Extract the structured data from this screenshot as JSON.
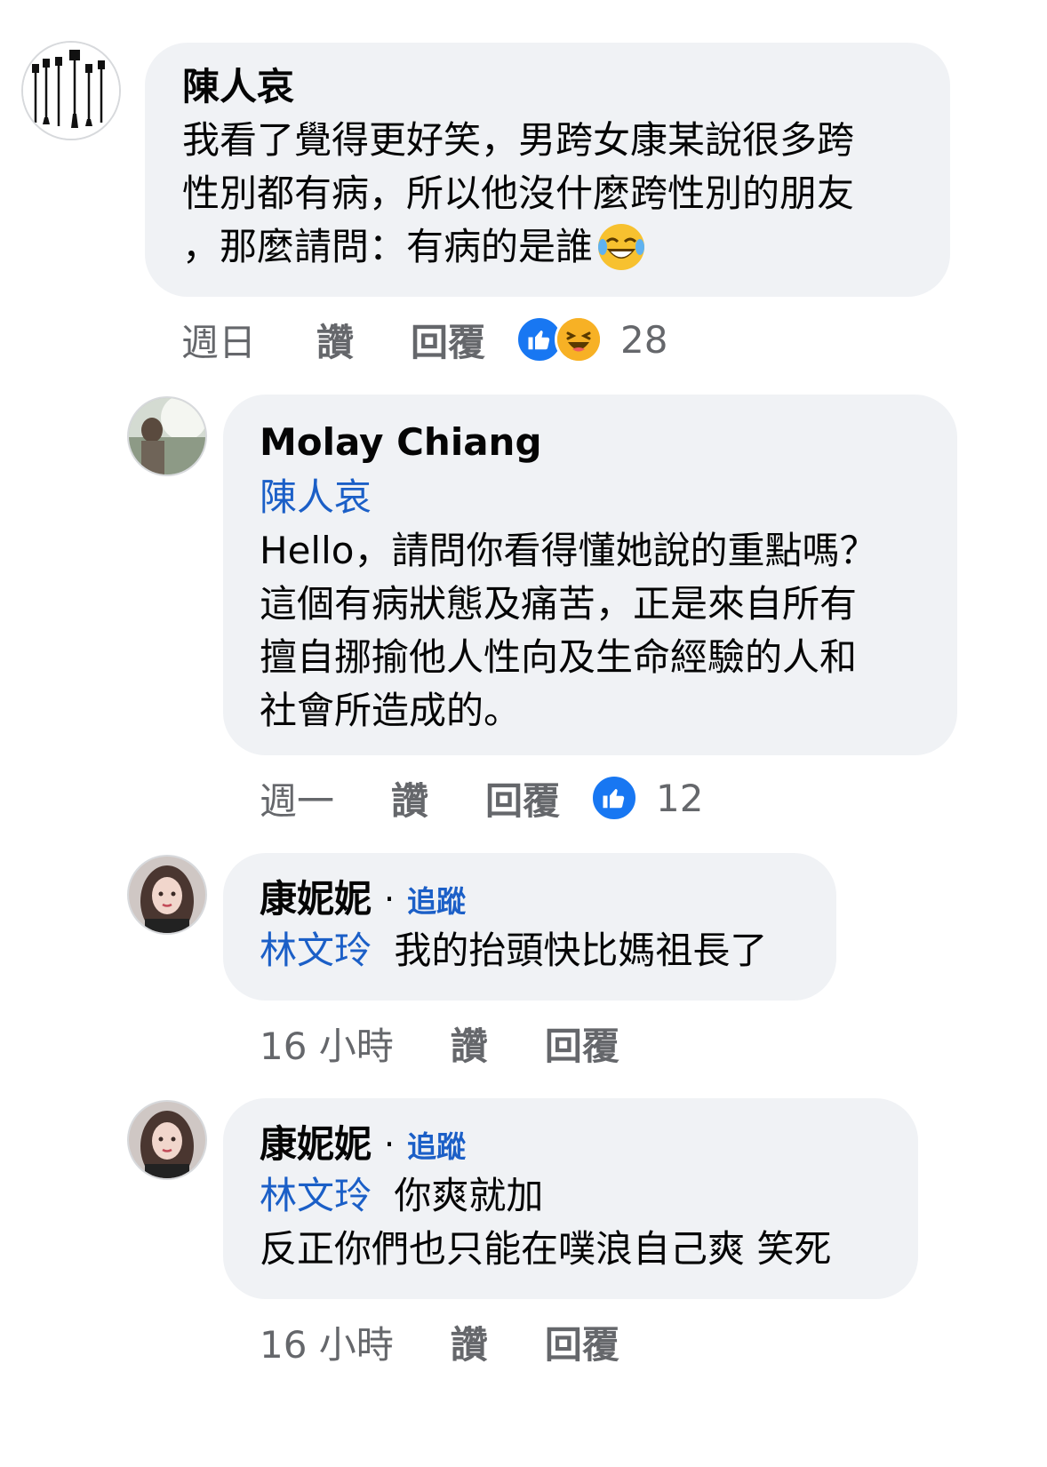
{
  "comments": [
    {
      "author": "陳人哀",
      "lines": [
        "我看了覺得更好笑，男跨女康某說很多跨",
        "性別都有病，所以他沒什麼跨性別的朋友",
        "，那麼請問：有病的是誰"
      ],
      "emoji": "😂",
      "time": "週日",
      "like_label": "讚",
      "reply_label": "回覆",
      "reaction_count": "28"
    },
    {
      "author": "Molay Chiang",
      "tag": "陳人哀",
      "lines": [
        "Hello，請問你看得懂她說的重點嗎？",
        "這個有病狀態及痛苦，正是來自所有",
        "擅自挪揄他人性向及生命經驗的人和",
        "社會所造成的。"
      ],
      "time": "週一",
      "like_label": "讚",
      "reply_label": "回覆",
      "reaction_count": "12"
    },
    {
      "author": "康妮妮",
      "separator": "·",
      "follow_label": "追蹤",
      "tag": "林文玲",
      "text": "我的抬頭快比媽祖長了",
      "time": "16 小時",
      "like_label": "讚",
      "reply_label": "回覆"
    },
    {
      "author": "康妮妮",
      "separator": "·",
      "follow_label": "追蹤",
      "tag": "林文玲",
      "text": "你爽就加",
      "line2": "反正你們也只能在噗浪自己爽 笑死",
      "time": "16 小時",
      "like_label": "讚",
      "reply_label": "回覆"
    }
  ],
  "icons": {
    "like": "like-reaction-icon",
    "haha": "haha-reaction-icon"
  },
  "colors": {
    "bubble": "#f0f2f5",
    "link": "#1b5fc7",
    "meta": "#65676b",
    "like": "#1877f2"
  }
}
